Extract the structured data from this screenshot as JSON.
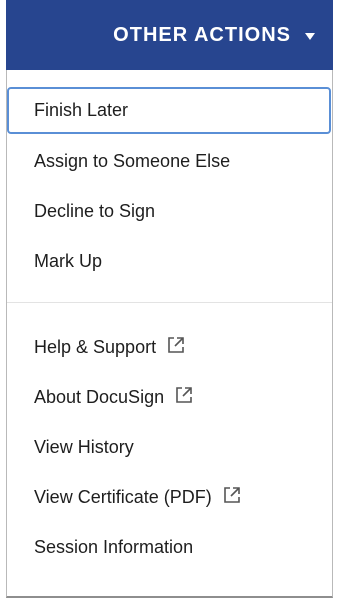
{
  "header": {
    "label": "OTHER ACTIONS",
    "caret_icon": "caret-down-icon",
    "background_color": "#27458f",
    "text_color": "#ffffff"
  },
  "menu": {
    "groups": [
      {
        "items": [
          {
            "label": "Finish Later",
            "focused": true,
            "external": false
          },
          {
            "label": "Assign to Someone Else",
            "focused": false,
            "external": false
          },
          {
            "label": "Decline to Sign",
            "focused": false,
            "external": false
          },
          {
            "label": "Mark Up",
            "focused": false,
            "external": false
          }
        ]
      },
      {
        "items": [
          {
            "label": "Help & Support",
            "focused": false,
            "external": true
          },
          {
            "label": "About DocuSign",
            "focused": false,
            "external": true
          },
          {
            "label": "View History",
            "focused": false,
            "external": false
          },
          {
            "label": "View Certificate (PDF)",
            "focused": false,
            "external": true
          },
          {
            "label": "Session Information",
            "focused": false,
            "external": false
          }
        ]
      }
    ],
    "external_icon": "external-link-icon",
    "focus_color": "#5a8fd6"
  }
}
